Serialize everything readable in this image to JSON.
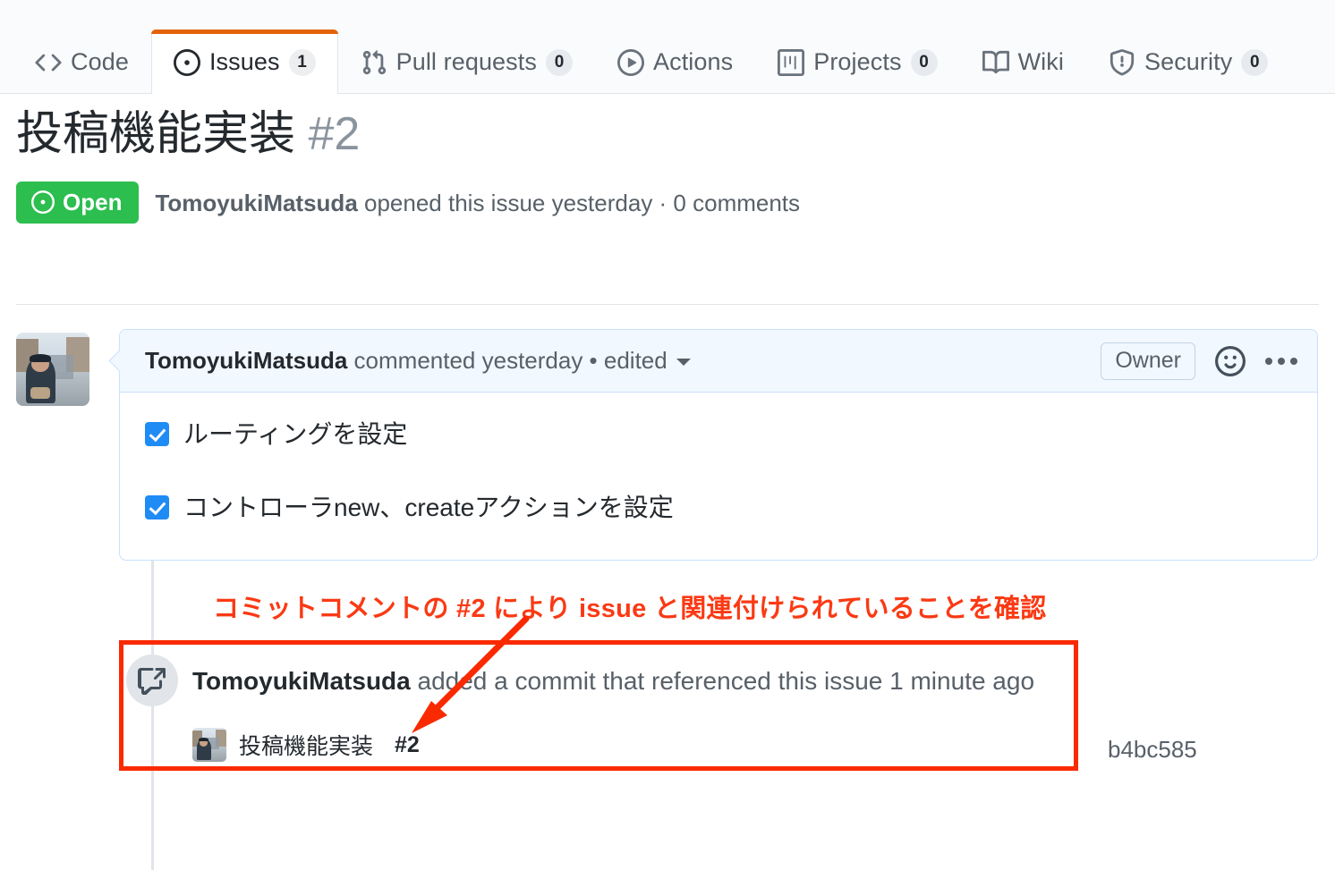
{
  "repo_nav": {
    "tabs": [
      {
        "label": "Code",
        "icon": "code-icon",
        "count": null,
        "selected": false
      },
      {
        "label": "Issues",
        "icon": "issue-opened-icon",
        "count": "1",
        "selected": true
      },
      {
        "label": "Pull requests",
        "icon": "git-pull-request-icon",
        "count": "0",
        "selected": false
      },
      {
        "label": "Actions",
        "icon": "play-icon",
        "count": null,
        "selected": false
      },
      {
        "label": "Projects",
        "icon": "project-icon",
        "count": "0",
        "selected": false
      },
      {
        "label": "Wiki",
        "icon": "book-icon",
        "count": null,
        "selected": false
      },
      {
        "label": "Security",
        "icon": "shield-icon",
        "count": "0",
        "selected": false
      }
    ],
    "selected_tab_accent": "#e36209"
  },
  "issue": {
    "title": "投稿機能実装",
    "number": "#2",
    "state": "Open",
    "state_icon": "issue-opened-icon",
    "state_color": "#2cbe4e",
    "meta_author": "TomoyukiMatsuda",
    "meta_rest": " opened this issue yesterday · 0 comments"
  },
  "comment": {
    "author": "TomoyukiMatsuda",
    "byline_rest": " commented yesterday • edited",
    "role_badge": "Owner",
    "reaction_icon": "smiley-icon",
    "menu_icon": "kebab-horizontal-icon",
    "tasks": [
      {
        "checked": true,
        "label": "ルーティングを設定"
      },
      {
        "checked": true,
        "label": "コントローラnew、createアクションを設定"
      }
    ]
  },
  "cross_reference": {
    "icon": "cross-reference-icon",
    "actor": "TomoyukiMatsuda",
    "text_rest": " added a commit that referenced this issue 1 minute ago",
    "commit_message": "投稿機能実装",
    "commit_issue_ref": "#2",
    "commit_sha": "b4bc585"
  },
  "annotation": {
    "text": "コミットコメントの #2 により issue と関連付けられていることを確認",
    "color": "#fa3a14",
    "box_color": "#fa2a00",
    "arrow": "points-down-left-to-commit-row"
  }
}
